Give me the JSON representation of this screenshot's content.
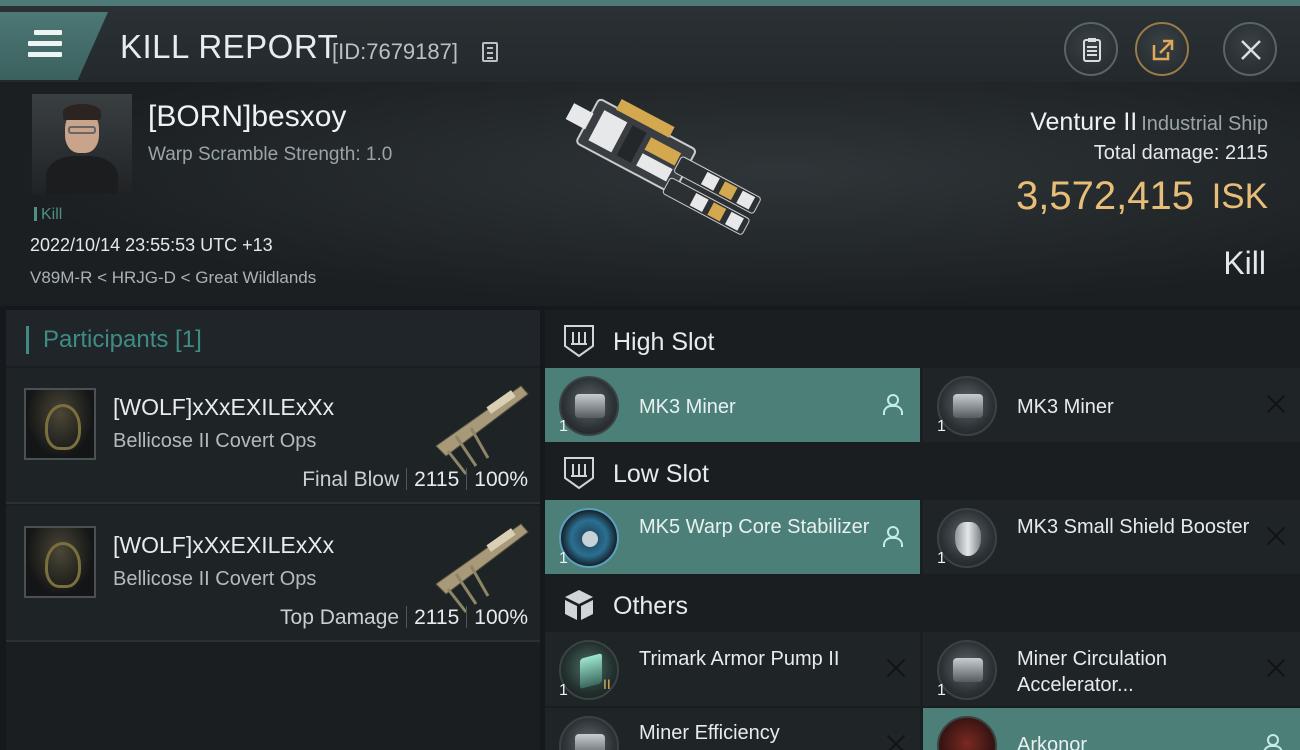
{
  "header": {
    "title": "KILL REPORT",
    "report_id": "[ID:7679187]",
    "menu_icon": "hamburger-menu-icon",
    "copy_icon": "copy-icon",
    "clipboard_icon": "clipboard-icon",
    "share_icon": "share-icon",
    "close_icon": "close-icon"
  },
  "victim": {
    "name": "[BORN]besxoy",
    "warp_scramble": "Warp Scramble Strength: 1.0",
    "kill_tag": "Kill",
    "timestamp": "2022/10/14 23:55:53 UTC +13",
    "location": "V89M-R < HRJG-D < Great Wildlands",
    "ship_name": "Venture II",
    "ship_class": "Industrial Ship",
    "total_damage_label": "Total damage:",
    "total_damage": "2115",
    "isk_value": "3,572,415",
    "isk_unit": "ISK",
    "result": "Kill"
  },
  "participants": {
    "title": "Participants [1]",
    "items": [
      {
        "name": "[WOLF]xXxEXILExXx",
        "ship": "Bellicose II Covert Ops",
        "role": "Final Blow",
        "damage": "2115",
        "percent": "100%"
      },
      {
        "name": "[WOLF]xXxEXILExXx",
        "ship": "Bellicose II Covert Ops",
        "role": "Top Damage",
        "damage": "2115",
        "percent": "100%"
      }
    ]
  },
  "fittings": {
    "high_slot": {
      "title": "High Slot",
      "modules": [
        {
          "name": "MK3 Miner",
          "qty": "1",
          "state": "fitted",
          "status_icon": "pilot-icon"
        },
        {
          "name": "MK3 Miner",
          "qty": "1",
          "state": "destroyed",
          "status_icon": "x-icon"
        }
      ]
    },
    "low_slot": {
      "title": "Low Slot",
      "modules": [
        {
          "name": "MK5 Warp Core Stabilizer",
          "qty": "1",
          "state": "fitted",
          "status_icon": "pilot-icon"
        },
        {
          "name": "MK3 Small Shield Booster",
          "qty": "1",
          "state": "destroyed",
          "status_icon": "x-icon"
        }
      ]
    },
    "others": {
      "title": "Others",
      "modules": [
        {
          "name": "Trimark Armor Pump II",
          "qty": "1",
          "tier": "II",
          "state": "destroyed",
          "status_icon": "x-icon"
        },
        {
          "name": "Miner Circulation Accelerator...",
          "qty": "1",
          "state": "destroyed",
          "status_icon": "x-icon"
        },
        {
          "name": "Miner Efficiency",
          "qty": "",
          "state": "destroyed",
          "status_icon": "x-icon"
        },
        {
          "name": "Arkonor",
          "qty": "",
          "state": "fitted",
          "status_icon": "pilot-icon"
        }
      ]
    }
  },
  "colors": {
    "accent_teal": "#4d7f79",
    "isk_gold": "#e8bd78",
    "background": "#15191d"
  }
}
